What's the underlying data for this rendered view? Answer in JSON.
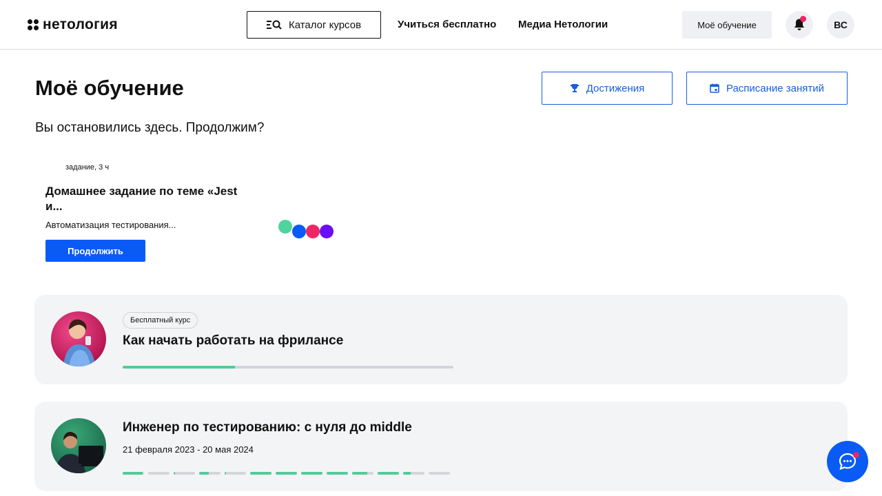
{
  "header": {
    "logo_text": "нетология",
    "catalog_label": "Каталог курсов",
    "nav": [
      "Учиться бесплатно",
      "Медиа Нетологии"
    ],
    "my_learning_label": "Моё обучение",
    "avatar_initials": "ВС",
    "has_notification": true
  },
  "page": {
    "title": "Моё обучение",
    "achievements_label": "Достижения",
    "schedule_label": "Расписание занятий",
    "resume_text": "Вы остановились здесь. Продолжим?"
  },
  "current_task": {
    "meta": "задание, 3 ч",
    "title": "Домашнее задание по теме «Jest и...",
    "subtitle": "Автоматизация тестирования...",
    "continue_label": "Продолжить"
  },
  "courses": [
    {
      "badge": "Бесплатный курс",
      "title": "Как начать работать на фрилансе",
      "progress": 0.34
    },
    {
      "title": "Инженер по тестированию: с нуля до middle",
      "dates": "21 февраля 2023 - 20 мая 2024",
      "segments": [
        0.95,
        0,
        0.05,
        0.45,
        0.05,
        1,
        1,
        1,
        1,
        0.7,
        1,
        0.35,
        0
      ]
    }
  ],
  "colors": {
    "accent": "#0a5bf5",
    "outline_accent": "#1561d8",
    "progress": "#4fcb99",
    "notification": "#ec2766",
    "card_bg": "#f3f4f6",
    "dots": [
      "#4fd49e",
      "#0a5bf5",
      "#ec2766",
      "#6b0ef5"
    ]
  },
  "icons": {
    "catalog": "list-search-icon",
    "bell": "bell-icon",
    "trophy": "trophy-icon",
    "calendar": "calendar-icon",
    "chat": "chat-icon"
  }
}
